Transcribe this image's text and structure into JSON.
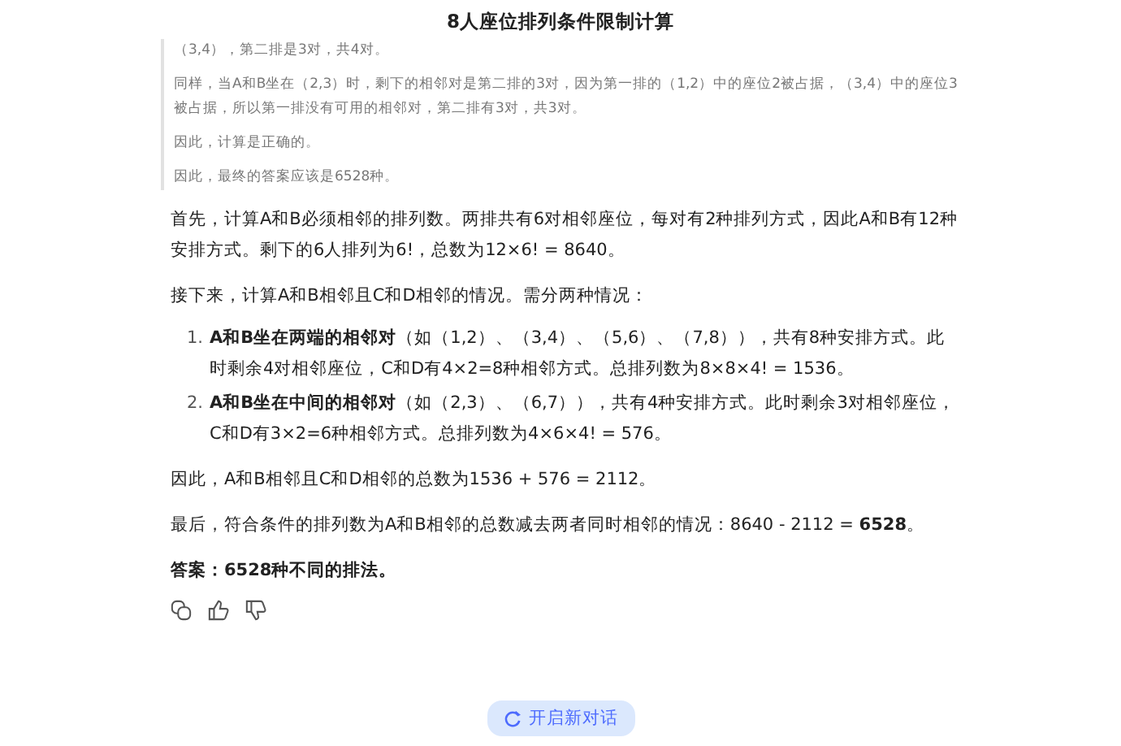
{
  "title": "8人座位排列条件限制计算",
  "quote": [
    "（3,4），第二排是3对，共4对。",
    "同样，当A和B坐在（2,3）时，剩下的相邻对是第二排的3对，因为第一排的（1,2）中的座位2被占据，（3,4）中的座位3被占据，所以第一排没有可用的相邻对，第二排有3对，共3对。",
    "因此，计算是正确的。",
    "因此，最终的答案应该是6528种。"
  ],
  "body": [
    {
      "kind": "p",
      "text": "首先，计算A和B必须相邻的排列数。两排共有6对相邻座位，每对有2种排列方式，因此A和B有12种安排方式。剩下的6人排列为6!，总数为12×6! = 8640。"
    },
    {
      "kind": "p",
      "text": "接下来，计算A和B相邻且C和D相邻的情况。需分两种情况："
    },
    {
      "kind": "ol",
      "items": [
        {
          "number": "1.",
          "text": "**A和B坐在两端的相邻对**（如（1,2）、（3,4）、（5,6）、（7,8）），共有8种安排方式。此时剩余4对相邻座位，C和D有4×2=8种相邻方式。总排列数为8×8×4! = 1536。"
        },
        {
          "number": "2.",
          "text": "**A和B坐在中间的相邻对**（如（2,3）、（6,7）），共有4种安排方式。此时剩余3对相邻座位，C和D有3×2=6种相邻方式。总排列数为4×6×4! = 576。"
        }
      ]
    },
    {
      "kind": "p",
      "text": "因此，A和B相邻且C和D相邻的总数为1536 + 576 = 2112。"
    },
    {
      "kind": "p",
      "text": "最后，符合条件的排列数为A和B相邻的总数减去两者同时相邻的情况：8640 - 2112 = **6528**。"
    },
    {
      "kind": "strong",
      "text": "答案：6528种不同的排法。"
    }
  ],
  "new_chat_button": "开启新对话"
}
